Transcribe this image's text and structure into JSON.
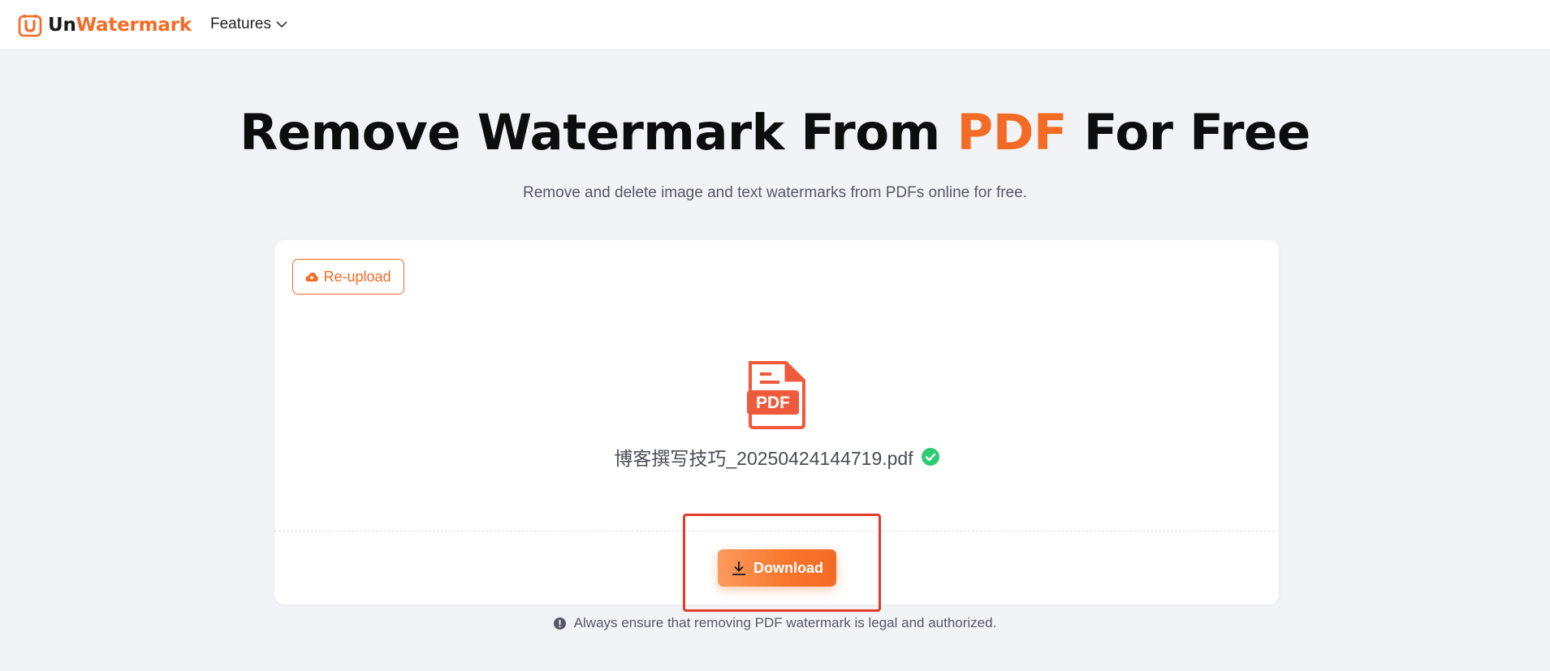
{
  "header": {
    "logo": {
      "part1": "Un",
      "part2": "Watermark"
    },
    "nav": {
      "features_label": "Features"
    }
  },
  "hero": {
    "title_pre": "Remove Watermark From ",
    "title_accent": "PDF",
    "title_post": " For Free",
    "subtitle": "Remove and delete image and text watermarks from PDFs online for free."
  },
  "card": {
    "reupload_label": "Re-upload",
    "pdf_icon_label": "PDF",
    "filename": "博客撰写技巧_20250424144719.pdf",
    "download_label": "Download"
  },
  "notice": {
    "text": "Always ensure that removing PDF watermark is legal and authorized."
  },
  "colors": {
    "accent": "#f36b24",
    "success": "#2ecc71",
    "highlight": "#e23b2c"
  },
  "icons": [
    "logo-icon",
    "chevron-down-icon",
    "cloud-upload-icon",
    "pdf-file-icon",
    "check-circle-icon",
    "download-icon",
    "info-icon"
  ]
}
